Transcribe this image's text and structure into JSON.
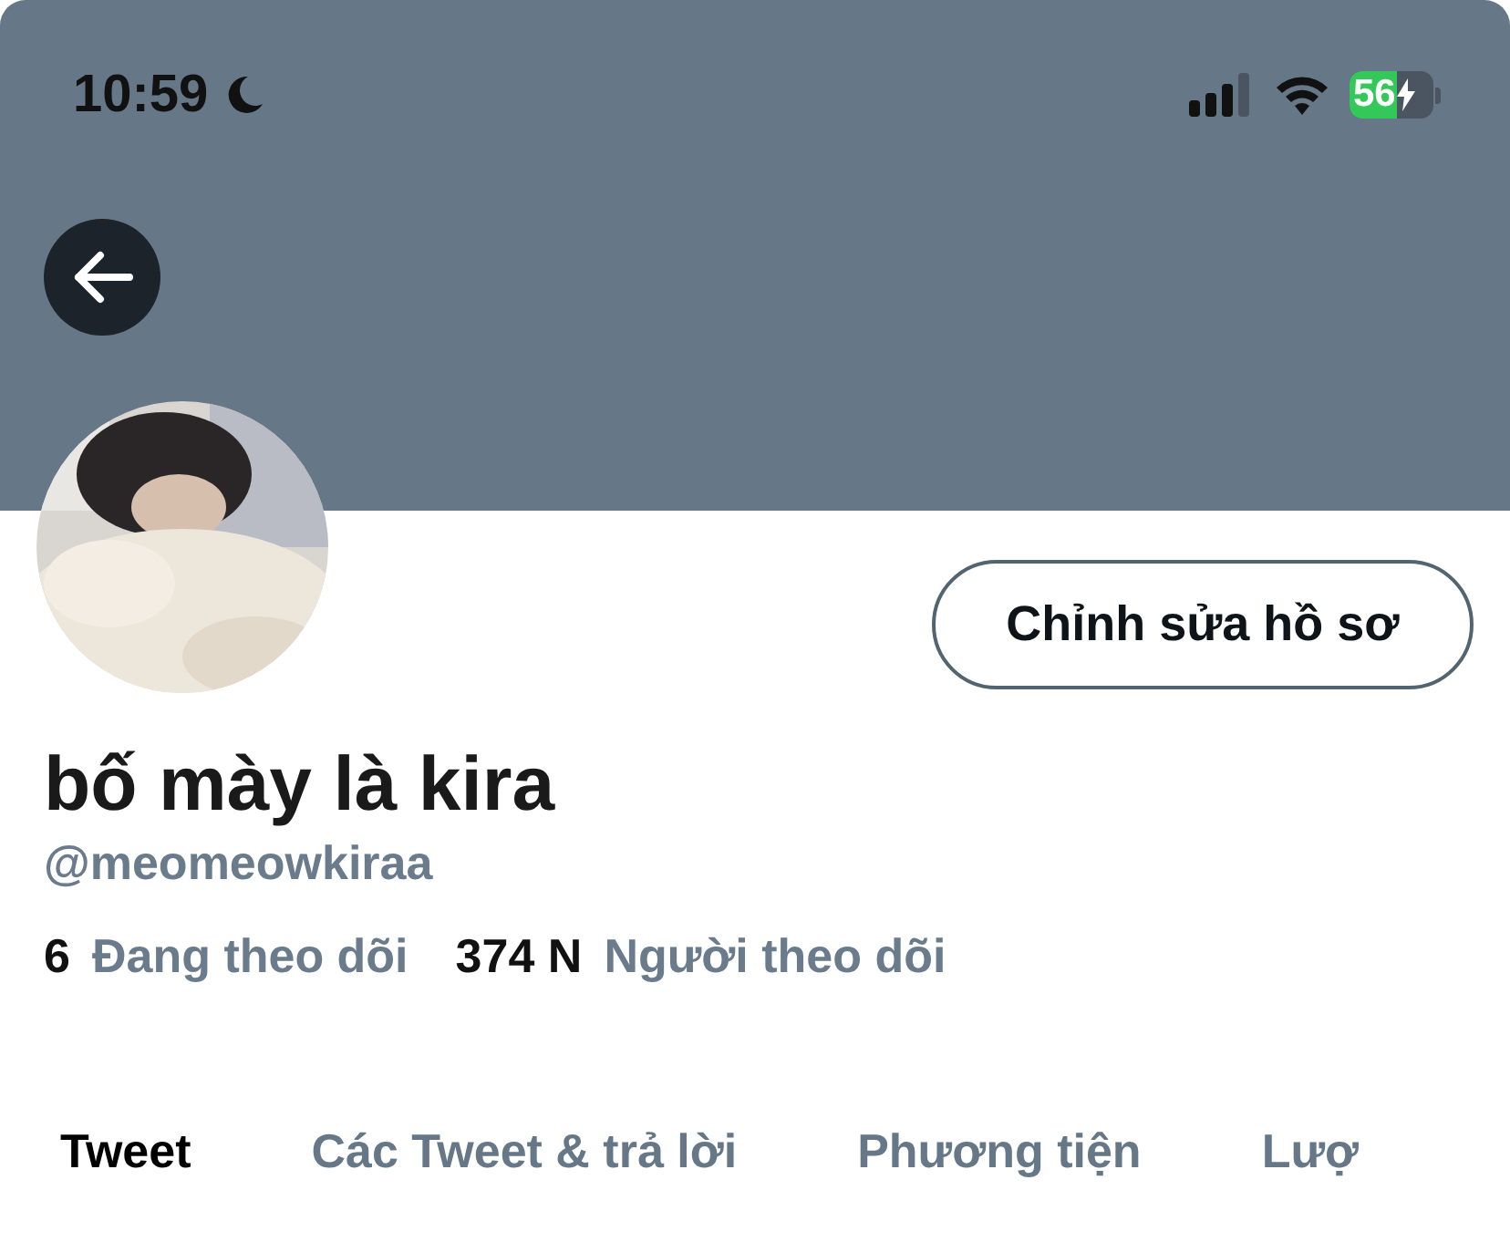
{
  "status_bar": {
    "time": "10:59",
    "battery": "56"
  },
  "profile": {
    "edit_button": "Chỉnh sửa hồ sơ",
    "name": "bố mày là kira",
    "handle": "@meomeowkiraa",
    "stats": [
      {
        "count": "6",
        "label": "Đang theo dõi"
      },
      {
        "count": "374 N",
        "label": "Người theo dõi"
      }
    ]
  },
  "tabs": [
    {
      "label": "Tweet",
      "selected": true
    },
    {
      "label": "Các Tweet & trả lời",
      "selected": false
    },
    {
      "label": "Phương tiện",
      "selected": false
    },
    {
      "label": "Lượ",
      "selected": false
    }
  ]
}
